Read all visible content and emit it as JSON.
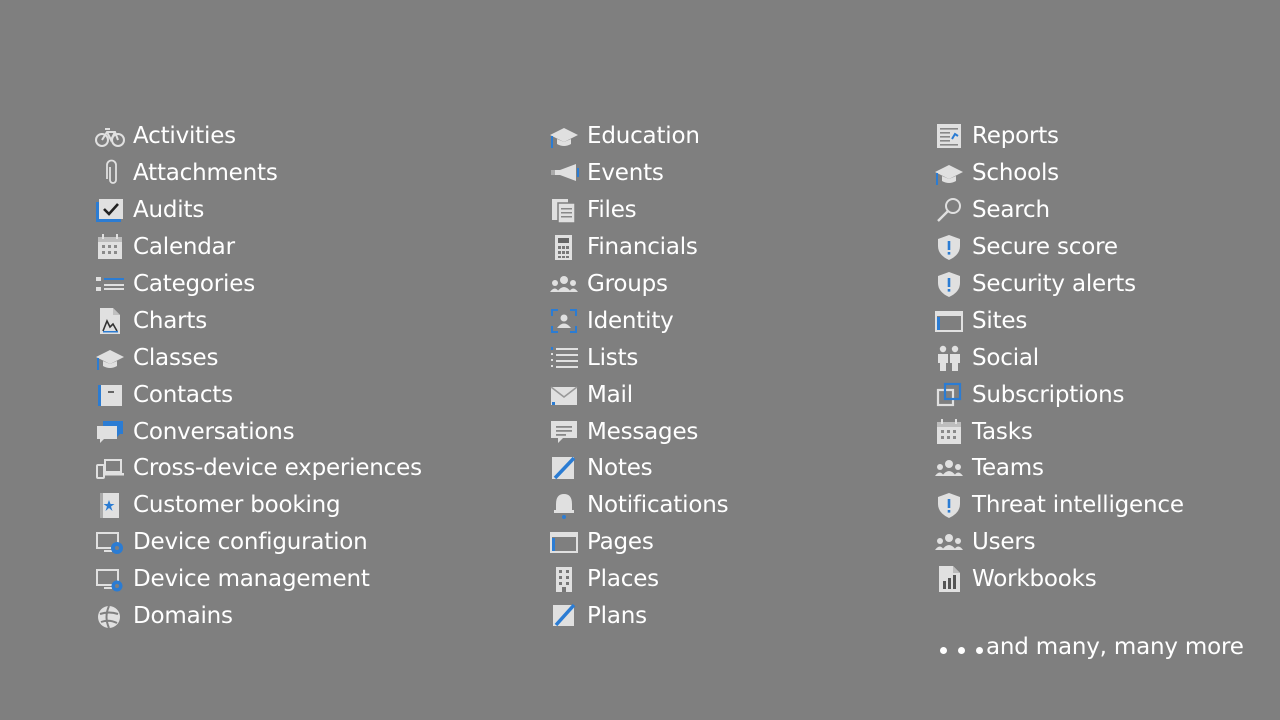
{
  "columns": [
    [
      {
        "label": "Activities",
        "icon": "bicycle-icon"
      },
      {
        "label": "Attachments",
        "icon": "paperclip-icon"
      },
      {
        "label": "Audits",
        "icon": "checklist-icon"
      },
      {
        "label": "Calendar",
        "icon": "calendar-icon"
      },
      {
        "label": "Categories",
        "icon": "categories-list-icon"
      },
      {
        "label": "Charts",
        "icon": "chart-document-icon"
      },
      {
        "label": "Classes",
        "icon": "graduation-cap-icon"
      },
      {
        "label": "Contacts",
        "icon": "contact-card-icon"
      },
      {
        "label": "Conversations",
        "icon": "chat-bubbles-icon"
      },
      {
        "label": "Cross-device experiences",
        "icon": "devices-icon"
      },
      {
        "label": "Customer booking",
        "icon": "booking-book-icon"
      },
      {
        "label": "Device configuration",
        "icon": "device-gear-icon"
      },
      {
        "label": "Device management",
        "icon": "device-manage-icon"
      },
      {
        "label": "Domains",
        "icon": "globe-icon"
      }
    ],
    [
      {
        "label": "Education",
        "icon": "graduation-cap-icon"
      },
      {
        "label": "Events",
        "icon": "megaphone-icon"
      },
      {
        "label": "Files",
        "icon": "files-icon"
      },
      {
        "label": "Financials",
        "icon": "calculator-icon"
      },
      {
        "label": "Groups",
        "icon": "people-group-icon"
      },
      {
        "label": "Identity",
        "icon": "identity-frame-icon"
      },
      {
        "label": "Lists",
        "icon": "bulleted-list-icon"
      },
      {
        "label": "Mail",
        "icon": "envelope-icon"
      },
      {
        "label": "Messages",
        "icon": "message-bubble-icon"
      },
      {
        "label": "Notes",
        "icon": "note-pen-icon"
      },
      {
        "label": "Notifications",
        "icon": "bell-icon"
      },
      {
        "label": "Pages",
        "icon": "browser-page-icon"
      },
      {
        "label": "Places",
        "icon": "building-icon"
      },
      {
        "label": "Plans",
        "icon": "plan-pen-icon"
      }
    ],
    [
      {
        "label": "Reports",
        "icon": "report-icon"
      },
      {
        "label": "Schools",
        "icon": "graduation-cap-icon"
      },
      {
        "label": "Search",
        "icon": "magnifier-icon"
      },
      {
        "label": "Secure score",
        "icon": "shield-alert-icon"
      },
      {
        "label": "Security alerts",
        "icon": "shield-alert-icon"
      },
      {
        "label": "Sites",
        "icon": "browser-page-icon"
      },
      {
        "label": "Social",
        "icon": "two-people-icon"
      },
      {
        "label": "Subscriptions",
        "icon": "subscriptions-icon"
      },
      {
        "label": "Tasks",
        "icon": "calendar-icon"
      },
      {
        "label": "Teams",
        "icon": "people-group-icon"
      },
      {
        "label": "Threat intelligence",
        "icon": "shield-alert-icon"
      },
      {
        "label": "Users",
        "icon": "people-group-icon"
      },
      {
        "label": "Workbooks",
        "icon": "workbook-chart-icon"
      }
    ]
  ],
  "footer": {
    "text": "and many, many more",
    "icon": "ellipsis-dots-icon"
  },
  "colors": {
    "background": "#7f7f7f",
    "text": "#ffffff",
    "icon": "#e0e0e0",
    "accent": "#2b7cd3"
  }
}
